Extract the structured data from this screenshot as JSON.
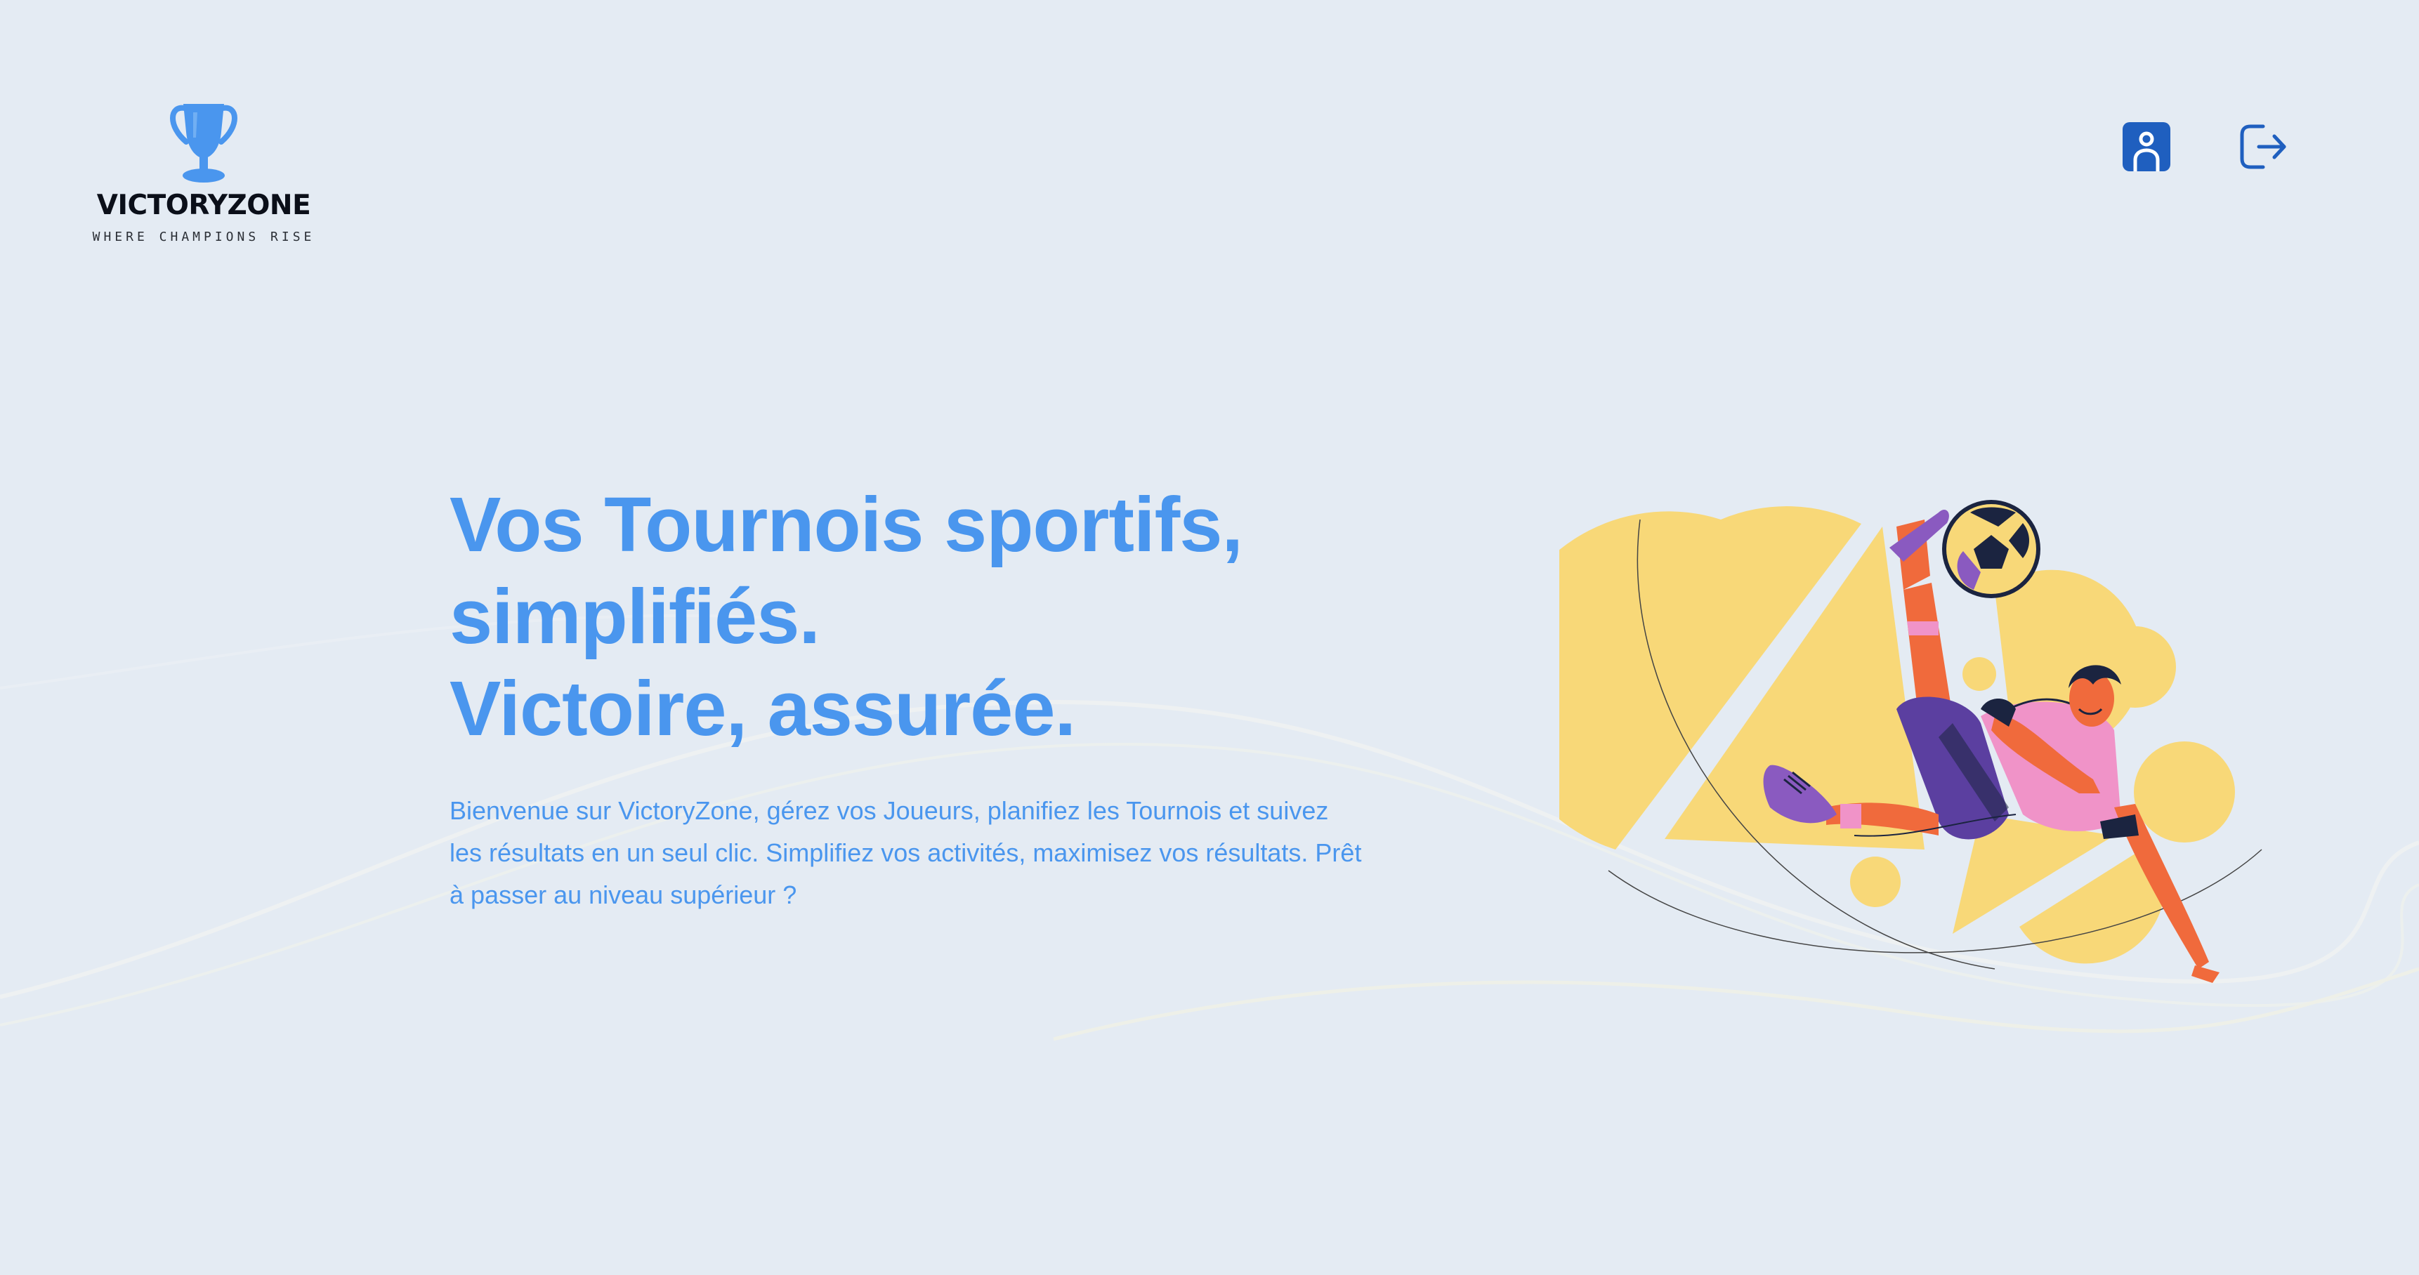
{
  "brand": {
    "name": "VICTORYZONE",
    "tagline": "WHERE CHAMPIONS RISE"
  },
  "header": {
    "profile_icon": "user-profile-icon",
    "logout_icon": "logout-icon"
  },
  "hero": {
    "title_line1": "Vos Tournois sportifs,",
    "title_line2": "simplifiés.",
    "title_line3": "Victoire, assurée.",
    "description": "Bienvenue sur VictoryZone, gérez vos Joueurs, planifiez les Tournois et suivez les résultats en un seul clic. Simplifiez vos activités, maximisez vos résultats. Prêt à passer au niveau supérieur ?"
  },
  "illustration": {
    "subject": "football-player-bicycle-kick-illustration"
  },
  "colors": {
    "background": "#e4ebf3",
    "accent": "#4a96ee",
    "profile_button": "#1f5fbf",
    "shapes_yellow": "#f8d878",
    "logo_text": "#0b0f19"
  }
}
